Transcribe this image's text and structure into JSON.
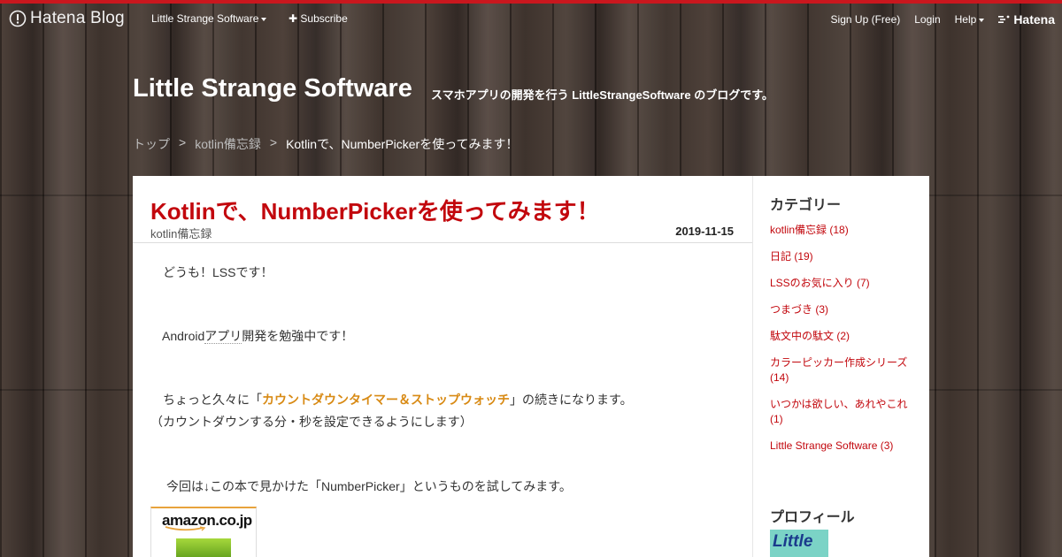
{
  "globalbar": {
    "logo_text": "Hatena Blog",
    "blog_menu": "Little Strange Software",
    "subscribe": "Subscribe",
    "signup": "Sign Up (Free)",
    "login": "Login",
    "help": "Help",
    "hatena": "Hatena",
    "accent_color": "#c9171e"
  },
  "blog": {
    "title": "Little Strange Software",
    "description": "スマホアプリの開発を行う LittleStrangeSoftware のブログです。"
  },
  "breadcrumb": {
    "items": [
      "トップ",
      "kotlin備忘録"
    ],
    "separator": ">",
    "current": "Kotlinで、NumberPickerを使ってみます！"
  },
  "entry": {
    "title": "Kotlinで、NumberPickerを使ってみます！",
    "category": "kotlin備忘録",
    "date": "2019-11-15",
    "lines": {
      "l1": "どうも！LSSです！",
      "l2a": "Android",
      "l2b": "アプリ",
      "l2c": "開発を勉強中です！",
      "l3a": "ちょっと久々に「",
      "l3link": "カウントダウンタイマー＆ストップウォッチ",
      "l3b": "」の続きになります。",
      "l4": "（カウントダウンする分・秒を設定できるようにします）",
      "l5": "今回は↓この本で見かけた「NumberPicker」というものを試してみます。"
    },
    "amazon_logo": "amazon.co.jp",
    "title_color": "#c2070d",
    "link_color": "#d88a14"
  },
  "sidebar": {
    "categories_heading": "カテゴリー",
    "categories": [
      "kotlin備忘録 (18)",
      "日記 (19)",
      "LSSのお気に入り (7)",
      "つまづき (3)",
      "駄文中の駄文 (2)",
      "カラーピッカー作成シリーズ (14)",
      "いつかは欲しい、あれやこれ (1)",
      "Little Strange Software (3)"
    ],
    "profile_heading": "プロフィール",
    "profile_image_text": "Little"
  }
}
